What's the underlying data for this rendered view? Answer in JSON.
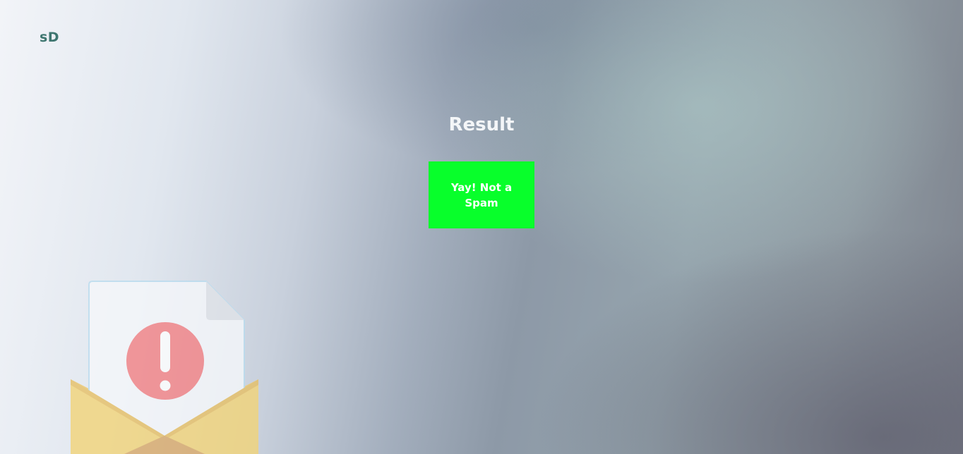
{
  "brand": {
    "logo_text": "sD"
  },
  "result": {
    "title": "Result",
    "verdict": "Yay! Not a Spam",
    "verdict_color": "#08ff2b"
  },
  "illustration": {
    "icon": "spam-alert-envelope-icon"
  }
}
